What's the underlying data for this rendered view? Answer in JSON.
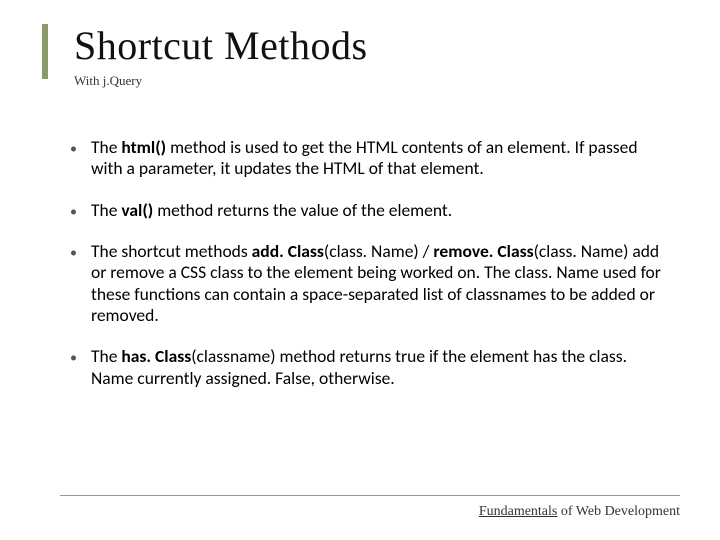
{
  "title": "Shortcut Methods",
  "subtitle": "With j.Query",
  "bullets": [
    {
      "pre": "The ",
      "bold": "html()",
      "post": " method is used to get the HTML contents of an element. If passed with a parameter, it updates the HTML of that element."
    },
    {
      "pre": "The ",
      "bold": "val()",
      "post": " method returns the value of the element."
    },
    {
      "pre": "The shortcut methods ",
      "bold": "add. Class",
      "post1": "(class. Name) / ",
      "bold2": "remove. Class",
      "post2": "(class. Name) add or remove a CSS class to the element being worked on. The class. Name used for these functions can contain a space-separated list of classnames to be added or removed."
    },
    {
      "pre": "The ",
      "bold": "has. Class",
      "post": "(classname) method returns true if the element has the class. Name currently assigned. False, otherwise."
    }
  ],
  "footer": {
    "underlined": "Fundamentals",
    "rest": " of Web Development"
  }
}
